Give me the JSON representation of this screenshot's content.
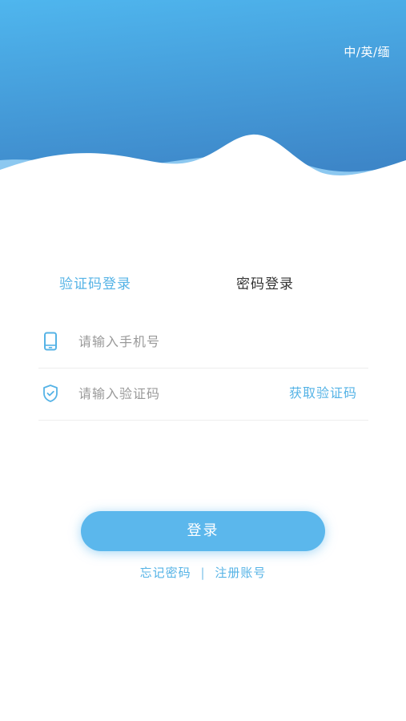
{
  "colors": {
    "accent": "#55b3e6",
    "header_top": "#4fb3ec",
    "header_bottom": "#3d84c6",
    "button": "#5bb7ec"
  },
  "header": {
    "language_switch": "中/英/缅"
  },
  "tabs": [
    {
      "label": "验证码登录",
      "active": true
    },
    {
      "label": "密码登录",
      "active": false
    }
  ],
  "form": {
    "phone": {
      "icon": "phone-icon",
      "placeholder": "请输入手机号",
      "value": ""
    },
    "code": {
      "icon": "shield-check-icon",
      "placeholder": "请输入验证码",
      "value": "",
      "get_code_label": "获取验证码"
    }
  },
  "login_button": "登录",
  "links": {
    "forgot_password": "忘记密码",
    "separator": "|",
    "register": "注册账号"
  }
}
